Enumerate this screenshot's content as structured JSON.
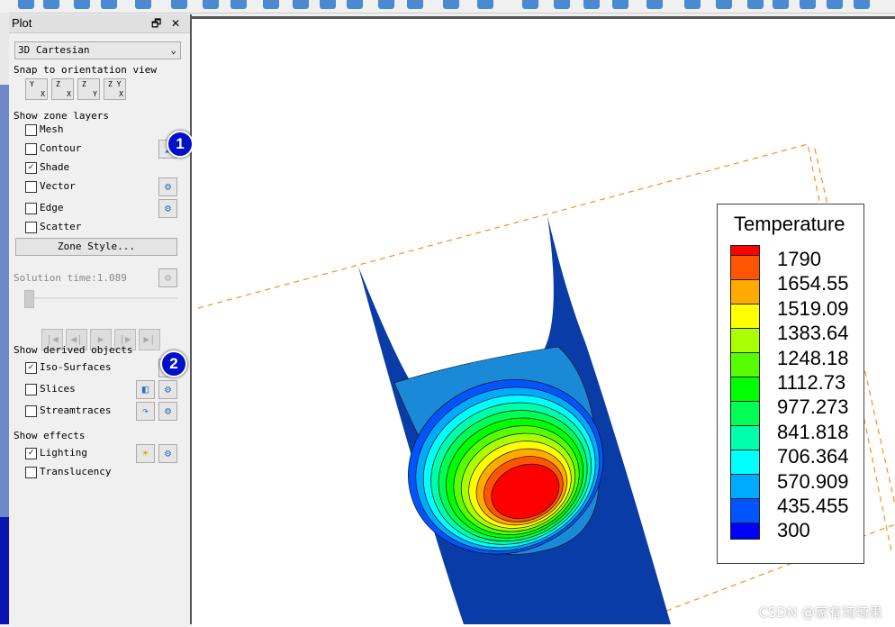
{
  "panel": {
    "title": "Plot",
    "restore_icon": "restore-icon",
    "close_icon": "close-icon",
    "plot_type": "3D Cartesian",
    "snap_label": "Snap to orientation view",
    "orient": [
      {
        "top": "Y",
        "bottom": "X"
      },
      {
        "top": "Z",
        "bottom": "X"
      },
      {
        "top": "Z",
        "bottom": "Y"
      },
      {
        "top": "Z Y",
        "bottom": "X"
      }
    ],
    "zone_layers_label": "Show zone layers",
    "layers": [
      {
        "label": "Mesh",
        "checked": false
      },
      {
        "label": "Contour",
        "checked": false
      },
      {
        "label": "Shade",
        "checked": true
      },
      {
        "label": "Vector",
        "checked": false
      },
      {
        "label": "Edge",
        "checked": false
      },
      {
        "label": "Scatter",
        "checked": false
      }
    ],
    "zone_style": "Zone Style...",
    "solution_time_label": "Solution time:",
    "solution_time": "1.089",
    "derived_label": "Show derived objects",
    "derived": [
      {
        "label": "Iso-Surfaces",
        "checked": true
      },
      {
        "label": "Slices",
        "checked": false
      },
      {
        "label": "Streamtraces",
        "checked": false
      }
    ],
    "effects_label": "Show effects",
    "effects": [
      {
        "label": "Lighting",
        "checked": true
      },
      {
        "label": "Translucency",
        "checked": false
      }
    ],
    "badges": [
      "1",
      "2"
    ]
  },
  "legend": {
    "title": "Temperature",
    "levels": [
      "1790",
      "1654.55",
      "1519.09",
      "1383.64",
      "1248.18",
      "1112.73",
      "977.273",
      "841.818",
      "706.364",
      "570.909",
      "435.455",
      "300"
    ],
    "colors": [
      "#ff0000",
      "#ff5500",
      "#ffaa00",
      "#ffff00",
      "#aaff00",
      "#55ff00",
      "#00ff00",
      "#00ff55",
      "#00ffaa",
      "#00ffff",
      "#00aaff",
      "#0055ff",
      "#0000ff"
    ]
  },
  "watermark": "CSDN @家有琦琦果"
}
